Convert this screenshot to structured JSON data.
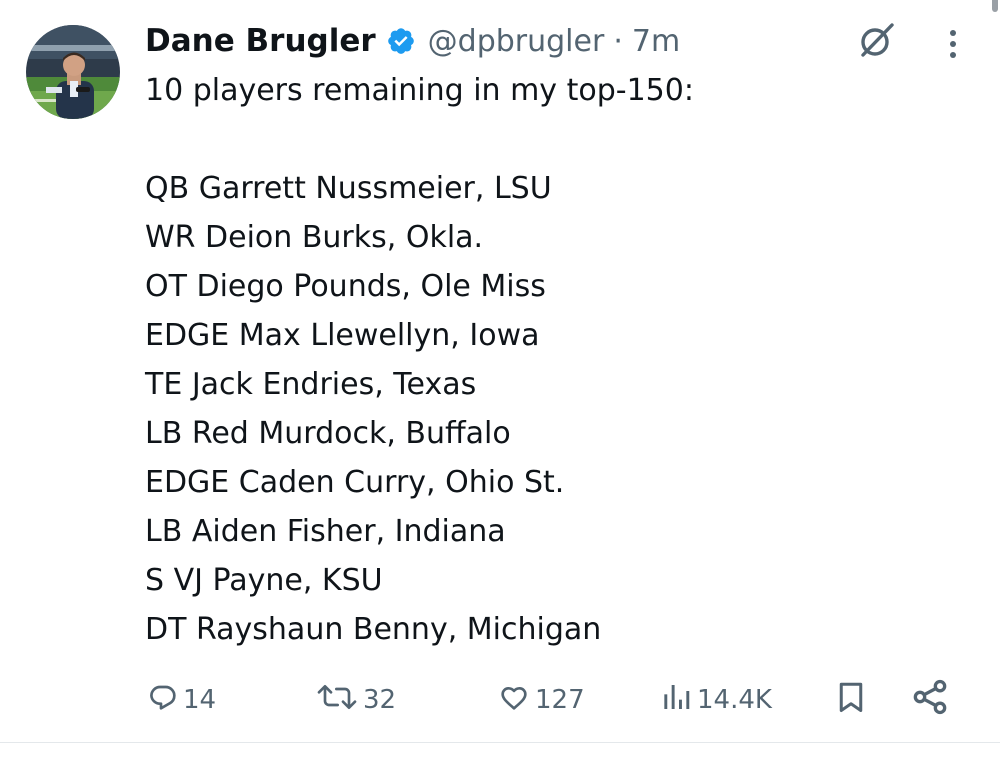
{
  "tweet": {
    "author": {
      "display_name": "Dane Brugler",
      "handle": "@dpbrugler",
      "verified": true,
      "verified_color": "#1d9bf0"
    },
    "separator": "·",
    "timestamp": "7m",
    "text": "10 players remaining in my top-150:\n\nQB Garrett Nussmeier, LSU\nWR Deion Burks, Okla.\nOT Diego Pounds, Ole Miss\nEDGE Max Llewellyn, Iowa\nTE Jack Endries, Texas\nLB Red Murdock, Buffalo\nEDGE Caden Curry, Ohio St.\nLB Aiden Fisher, Indiana\nS VJ Payne, KSU\nDT Rayshaun Benny, Michigan",
    "metrics": {
      "replies": "14",
      "reposts": "32",
      "likes": "127",
      "views": "14.4K"
    }
  },
  "icons": {
    "verified": "verified-badge-icon",
    "grok": "grok-icon",
    "more": "more-vertical-icon",
    "reply": "reply-icon",
    "repost": "repost-icon",
    "like": "heart-icon",
    "views": "views-chart-icon",
    "bookmark": "bookmark-icon",
    "share": "share-icon"
  },
  "colors": {
    "text_primary": "#0f1419",
    "text_secondary": "#536471",
    "accent": "#1d9bf0"
  }
}
